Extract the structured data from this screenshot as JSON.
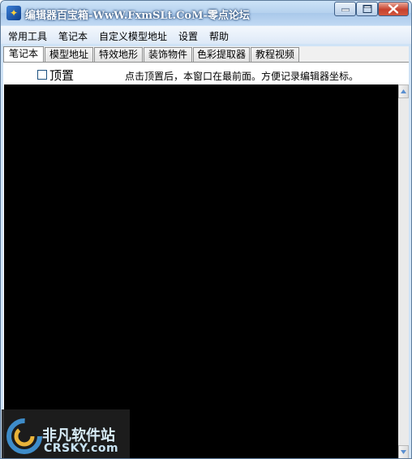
{
  "window": {
    "title": "编辑器百宝箱-WwW.FxmSLt.CoM-零点论坛",
    "icon": "app-logo-icon",
    "controls": [
      "minimize-icon",
      "maximize-icon",
      "close-icon"
    ]
  },
  "menu": {
    "items": [
      {
        "label": "常用工具"
      },
      {
        "label": "笔记本"
      },
      {
        "label": "自定义模型地址"
      },
      {
        "label": "设置"
      },
      {
        "label": "帮助"
      }
    ]
  },
  "tabs": [
    {
      "label": "笔记本",
      "active": true
    },
    {
      "label": "模型地址"
    },
    {
      "label": "特效地形"
    },
    {
      "label": "装饰物件"
    },
    {
      "label": "色彩提取器"
    },
    {
      "label": "教程视频"
    }
  ],
  "notebook": {
    "pin_checkbox_label": "顶置",
    "pin_checked": false,
    "hint": "点击顶置后，本窗口在最前面。方便记录编辑器坐标。"
  },
  "watermark": {
    "cn": "非凡软件站",
    "en": "CRSKY.com"
  },
  "colors": {
    "title_bar": "#b5d1ee",
    "close_button": "#c7412d",
    "editor_background": "#000000"
  }
}
